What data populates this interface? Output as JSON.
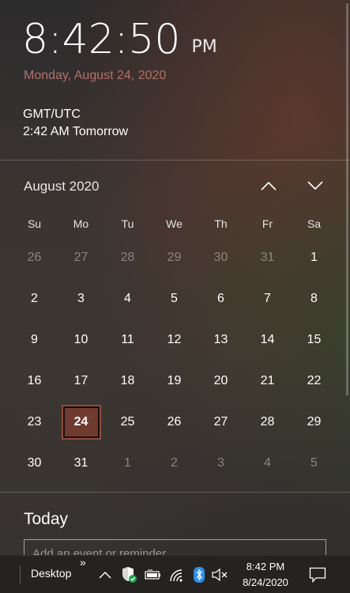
{
  "clock": {
    "time": "8:42:50",
    "ampm": "PM",
    "date": "Monday, August 24, 2020"
  },
  "extra_clock": {
    "name": "GMT/UTC",
    "time": "2:42 AM Tomorrow"
  },
  "calendar": {
    "month_title": "August 2020",
    "weekdays": [
      "Su",
      "Mo",
      "Tu",
      "We",
      "Th",
      "Fr",
      "Sa"
    ],
    "weeks": [
      [
        {
          "d": "26",
          "other": true
        },
        {
          "d": "27",
          "other": true
        },
        {
          "d": "28",
          "other": true
        },
        {
          "d": "29",
          "other": true
        },
        {
          "d": "30",
          "other": true
        },
        {
          "d": "31",
          "other": true
        },
        {
          "d": "1"
        }
      ],
      [
        {
          "d": "2"
        },
        {
          "d": "3"
        },
        {
          "d": "4"
        },
        {
          "d": "5"
        },
        {
          "d": "6"
        },
        {
          "d": "7"
        },
        {
          "d": "8"
        }
      ],
      [
        {
          "d": "9"
        },
        {
          "d": "10"
        },
        {
          "d": "11"
        },
        {
          "d": "12"
        },
        {
          "d": "13"
        },
        {
          "d": "14"
        },
        {
          "d": "15"
        }
      ],
      [
        {
          "d": "16"
        },
        {
          "d": "17"
        },
        {
          "d": "18"
        },
        {
          "d": "19"
        },
        {
          "d": "20"
        },
        {
          "d": "21"
        },
        {
          "d": "22"
        }
      ],
      [
        {
          "d": "23"
        },
        {
          "d": "24",
          "today": true
        },
        {
          "d": "25"
        },
        {
          "d": "26"
        },
        {
          "d": "27"
        },
        {
          "d": "28"
        },
        {
          "d": "29"
        }
      ],
      [
        {
          "d": "30"
        },
        {
          "d": "31"
        },
        {
          "d": "1",
          "other": true
        },
        {
          "d": "2",
          "other": true
        },
        {
          "d": "3",
          "other": true
        },
        {
          "d": "4",
          "other": true
        },
        {
          "d": "5",
          "other": true
        }
      ]
    ],
    "prev_icon": "chevron-up-icon",
    "next_icon": "chevron-down-icon"
  },
  "agenda": {
    "heading": "Today",
    "placeholder": "Add an event or reminder"
  },
  "taskbar": {
    "desktop_label": "Desktop",
    "expand_label": "»",
    "tray_icons": [
      "chevron-up-icon",
      "security-shield-icon",
      "battery-icon",
      "wifi-icon",
      "bluetooth-icon",
      "volume-muted-icon"
    ],
    "time": "8:42 PM",
    "date": "8/24/2020",
    "notification_icon": "action-center-icon"
  },
  "colors": {
    "accent": "#6f3a2f",
    "date_text": "#b4706a",
    "other_month_text": "#8a8583",
    "shield_green": "#1aa64a",
    "bluetooth_blue": "#2b8ee6"
  }
}
